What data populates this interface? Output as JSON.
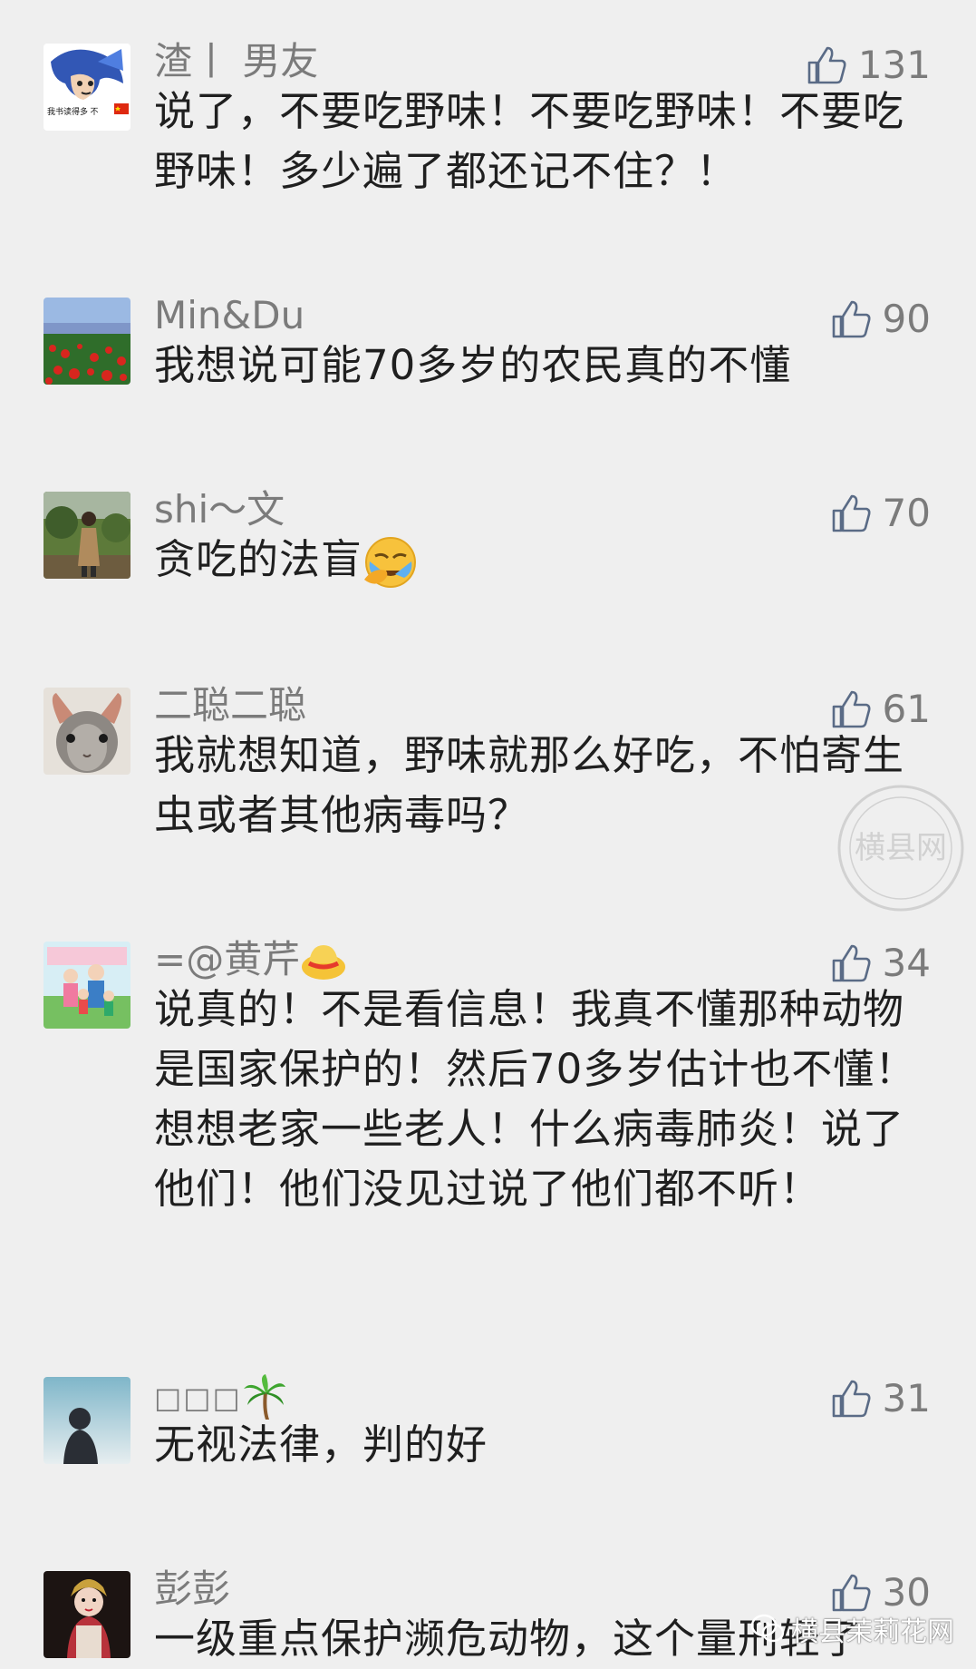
{
  "comments": [
    {
      "username": "渣丨 男友",
      "likes": "131",
      "text": "说了，不要吃野味！不要吃野味！不要吃野味！多少遍了都还记不住？！",
      "avatar": "cartoon-avatar",
      "avatar_caption": "我书读得多 不"
    },
    {
      "username": "Min&Du",
      "likes": "90",
      "text": "我想说可能70多岁的农民真的不懂",
      "avatar": "flower-field-avatar"
    },
    {
      "username": "shi～文",
      "likes": "70",
      "text": "贪吃的法盲",
      "avatar": "person-outdoors-avatar",
      "emoji": "face-palm-emoji"
    },
    {
      "username": "二聪二聪",
      "likes": "61",
      "text": "我就想知道，野味就那么好吃，不怕寄生虫或者其他病毒吗？",
      "avatar": "rabbit-avatar"
    },
    {
      "username": "=@黄芹",
      "likes": "34",
      "text": "说真的！不是看信息！我真不懂那种动物是国家保护的！然后70多岁估计也不懂！想想老家一些老人！什么病毒肺炎！说了他们！他们没见过说了他们都不听！",
      "avatar": "family-cartoon-avatar",
      "emoji": "straw-hat-emoji"
    },
    {
      "username": "□□□",
      "likes": "31",
      "text": "无视法律，判的好",
      "avatar": "silhouette-avatar",
      "emoji": "palm-tree-emoji"
    },
    {
      "username": "彭彭",
      "likes": "30",
      "text": "一级重点保护濒危动物，这个量刑轻了",
      "avatar": "opera-avatar"
    }
  ],
  "watermark": {
    "brand": "横县茉莉花网",
    "seal_text": "横县网"
  },
  "colors": {
    "background": "#efefef",
    "name": "#7b7b7b",
    "text": "#1f1f1f"
  }
}
